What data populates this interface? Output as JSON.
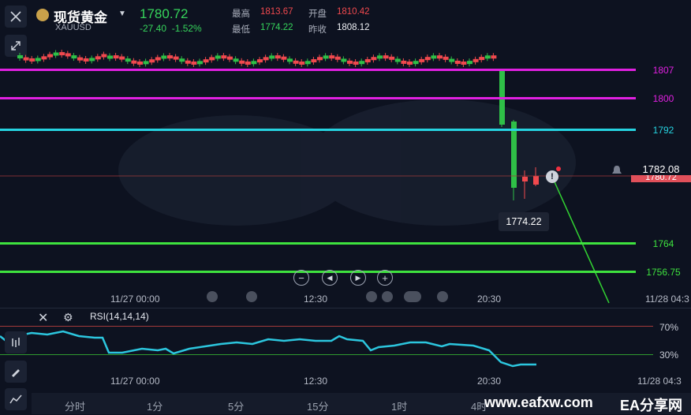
{
  "header": {
    "title": "现货黄金",
    "symbol": "XAUUSD",
    "price": "1780.72",
    "change": "-27.40",
    "change_pct": "-1.52%",
    "high_label": "最高",
    "high": "1813.67",
    "open_label": "开盘",
    "open": "1810.42",
    "low_label": "最低",
    "low": "1774.22",
    "prev_close_label": "昨收",
    "prev_close": "1808.12"
  },
  "levels": {
    "l1807": "1807",
    "l1800": "1800",
    "l1792": "1792",
    "l1764": "1764",
    "l1756": "1756.75"
  },
  "chart": {
    "current_price": "1782.08",
    "current_price_under": "1780.72",
    "low_marker": "1774.22"
  },
  "time_axis": {
    "t1": "11/27 00:00",
    "t2": "12:30",
    "t3": "20:30",
    "t4": "11/28 04:3"
  },
  "rsi": {
    "label": "RSI(14,14,14)",
    "high": "70%",
    "low": "30%"
  },
  "timeframes": [
    "分时",
    "1分",
    "5分",
    "15分",
    "1时",
    "4时"
  ],
  "watermark": {
    "url": "www.eafxw.com",
    "name": "EA分享网"
  },
  "colors": {
    "bull": "#f0494e",
    "bear": "#2fbf47",
    "magenta": "#e020e0",
    "cyan": "#26d3e0",
    "green_line": "#3ee23e"
  },
  "chart_data": {
    "type": "candlestick",
    "x_labels": [
      "11/27 00:00",
      "12:30",
      "20:30",
      "11/28 04:3"
    ],
    "horizontal_levels": [
      1807,
      1800,
      1792,
      1764,
      1756.75
    ],
    "session_low": 1774.22,
    "last_price": 1780.72,
    "ask_price": 1782.08
  }
}
